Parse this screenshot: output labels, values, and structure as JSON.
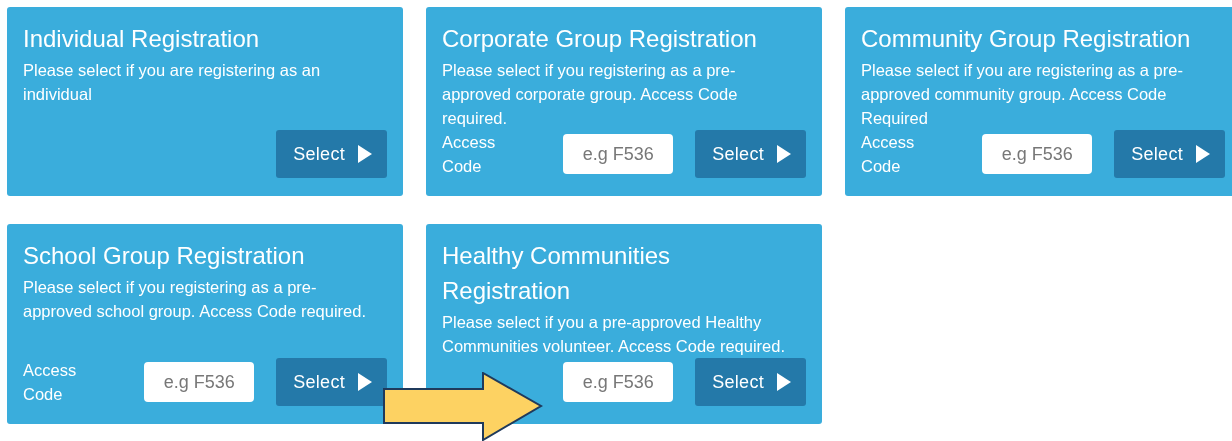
{
  "cards": [
    {
      "title": "Individual Registration",
      "description": "Please select if you are registering as an individual",
      "button": "Select"
    },
    {
      "title": "Corporate Group Registration",
      "description": "Please select if you registering as a pre-approved corporate group. Access Code required.",
      "access_label": "Access Code",
      "placeholder": "e.g F536",
      "button": "Select"
    },
    {
      "title": "Community Group Registration",
      "description": "Please select if you are registering as a pre-approved community group. Access Code Required",
      "access_label": "Access Code",
      "placeholder": "e.g F536",
      "button": "Select"
    },
    {
      "title": "School Group Registration",
      "description": "Please select if you registering as a pre-approved school group. Access Code required.",
      "access_label": "Access Code",
      "placeholder": "e.g F536",
      "button": "Select"
    },
    {
      "title": "Healthy Communities Registration",
      "description": "Please select if you a pre-approved Healthy Communities volunteer. Access Code required.",
      "placeholder": "e.g F536",
      "button": "Select"
    }
  ]
}
